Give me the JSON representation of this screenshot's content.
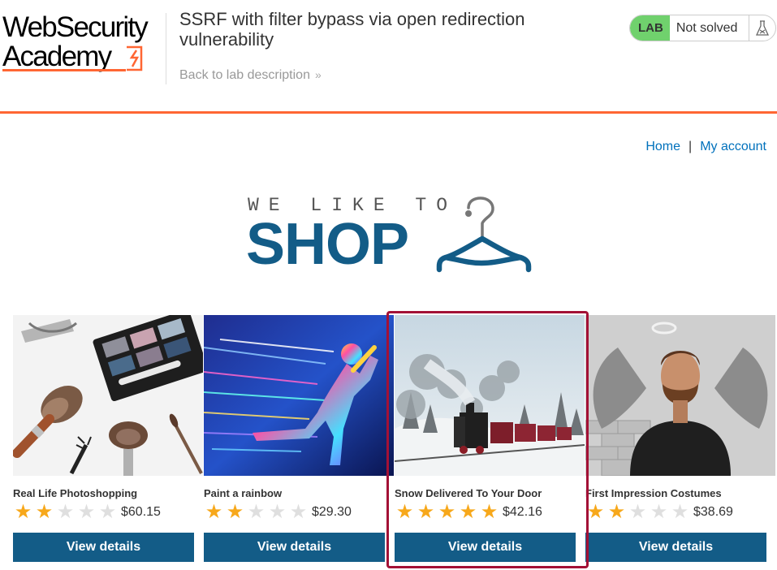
{
  "logo": {
    "line1": "WebSecurity",
    "line2": "Academy"
  },
  "lab": {
    "title": "SSRF with filter bypass via open redirection vulnerability",
    "back_link": "Back to lab description",
    "back_chevron": "»",
    "badge": "LAB",
    "status": "Not solved",
    "status_color": "#70d16d"
  },
  "nav": {
    "home": "Home",
    "separator": "|",
    "account": "My account"
  },
  "banner": {
    "tagline": "WE LIKE TO",
    "word": "SHOP"
  },
  "products": [
    {
      "name": "Real Life Photoshopping",
      "rating": 2,
      "price": "$60.15",
      "button": "View details"
    },
    {
      "name": "Paint a rainbow",
      "rating": 2,
      "price": "$29.30",
      "button": "View details"
    },
    {
      "name": "Snow Delivered To Your Door",
      "rating": 5,
      "price": "$42.16",
      "button": "View details"
    },
    {
      "name": "First Impression Costumes",
      "rating": 2,
      "price": "$38.69",
      "button": "View details"
    }
  ],
  "star_glyph": "★",
  "colors": {
    "accent": "#ff6633",
    "brand_blue": "#135c87",
    "link": "#0071bc",
    "star": "#f7a81b",
    "highlight": "#a31136"
  }
}
